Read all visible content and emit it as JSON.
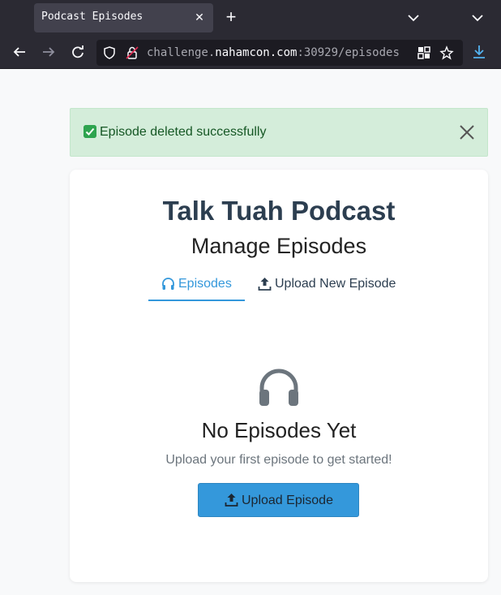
{
  "browser": {
    "tab_title": "Podcast Episodes",
    "url_prefix": "challenge.",
    "url_host": "nahamcon.com",
    "url_suffix": ":30929/episodes"
  },
  "alert": {
    "message": "Episode deleted successfully",
    "color": "#d4edda"
  },
  "header": {
    "title": "Talk Tuah Podcast",
    "subtitle": "Manage Episodes"
  },
  "tabs": [
    {
      "label": "Episodes",
      "icon": "headphones-icon",
      "active": true
    },
    {
      "label": "Upload New Episode",
      "icon": "upload-icon",
      "active": false
    }
  ],
  "empty_state": {
    "icon": "headphones-icon",
    "title": "No Episodes Yet",
    "subtitle": "Upload your first episode to get started!",
    "button_label": "Upload Episode"
  },
  "colors": {
    "accent": "#3498db",
    "title": "#2c3e50",
    "alert_bg": "#d4edda",
    "alert_text": "#155724"
  }
}
